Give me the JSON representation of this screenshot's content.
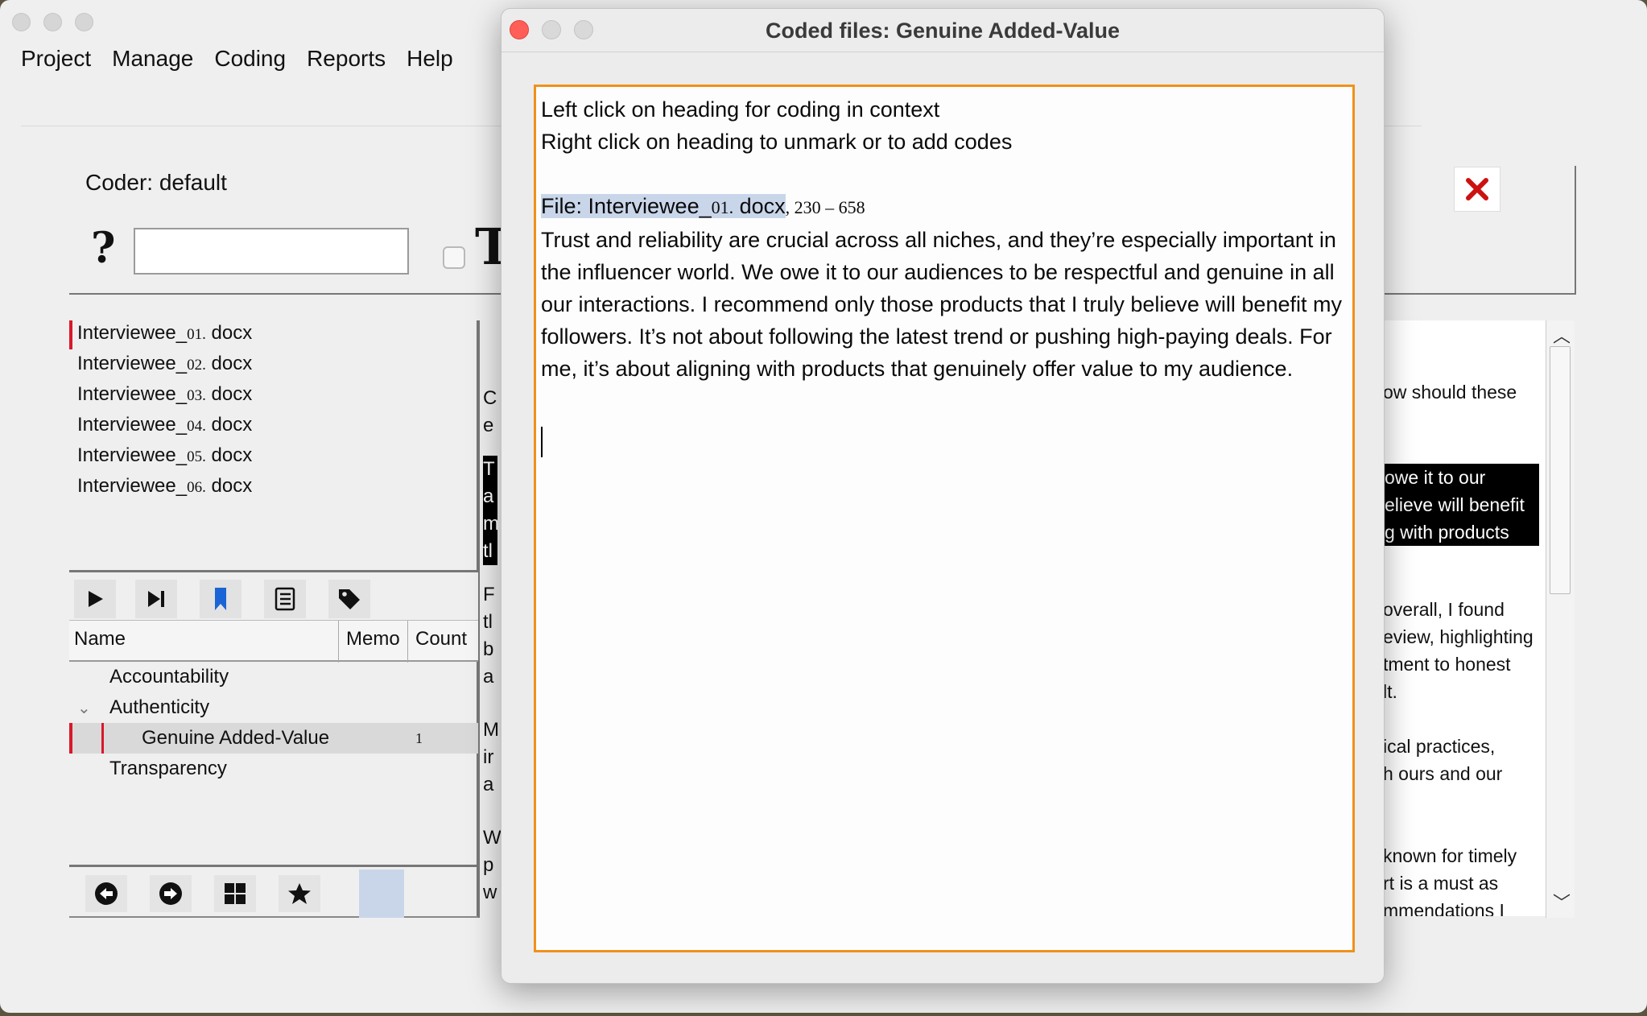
{
  "main_window": {
    "menu": [
      "Project",
      "Manage",
      "Coding",
      "Reports",
      "Help"
    ],
    "coder_label": "Coder: default",
    "help_symbol": "?",
    "search_value": "",
    "big_letter": "T",
    "files": [
      {
        "prefix": "Interviewee_",
        "num": "01.",
        "ext": " docx",
        "active": true
      },
      {
        "prefix": "Interviewee_",
        "num": "02.",
        "ext": " docx"
      },
      {
        "prefix": "Interviewee_",
        "num": "03.",
        "ext": " docx"
      },
      {
        "prefix": "Interviewee_",
        "num": "04.",
        "ext": " docx"
      },
      {
        "prefix": "Interviewee_",
        "num": "05.",
        "ext": " docx"
      },
      {
        "prefix": "Interviewee_",
        "num": "06.",
        "ext": " docx"
      }
    ],
    "code_table": {
      "headers": {
        "name": "Name",
        "memo": "Memo",
        "count": "Count"
      },
      "rows": [
        {
          "name": "Accountability",
          "count": ""
        },
        {
          "name": "Authenticity",
          "count": "",
          "expanded": true
        },
        {
          "name": "Genuine Added-Value",
          "count": "1",
          "selected": true
        },
        {
          "name": "Transparency",
          "count": ""
        }
      ]
    },
    "toolbar_icons": [
      "play-icon",
      "skip-next-icon",
      "bookmark-icon",
      "memo-list-icon",
      "tag-icon"
    ],
    "bottom_icons": [
      "back-arrow-icon",
      "forward-arrow-icon",
      "grid-icon",
      "star-icon"
    ],
    "mid_strip_letters": [
      "C",
      "e",
      "",
      "T",
      "a",
      "m",
      "tl",
      "",
      "F",
      "tl",
      "b",
      "a",
      "",
      "M",
      "ir",
      "a",
      "",
      "W",
      "p",
      "w"
    ],
    "right_text_lines": [
      "ow should these",
      "owe it to our",
      "elieve will benefit",
      "g with products",
      "overall, I found",
      "eview, highlighting",
      "tment to honest",
      "lt.",
      "ical practices,",
      "h ours and our",
      "known for timely",
      "rt is a must as",
      "mmendations I"
    ]
  },
  "dialog": {
    "title": "Coded files: Genuine Added-Value",
    "instruction_1": "Left click on heading for coding in context",
    "instruction_2": "Right click on heading to unmark or to add codes",
    "file_heading_label": "File:  Interviewee_",
    "file_heading_num": "01.",
    "file_heading_ext": " docx",
    "file_range": ", 230 – 658",
    "coded_text": "Trust and reliability are crucial across all niches, and they’re especially important in the influencer world.  We owe it to our audiences to be respectful and genuine in all our interactions.  I recommend only those products that I truly believe will benefit my followers.  It’s not about following the latest trend or pushing high-paying deals.  For me, it’s about aligning with products that genuinely offer value to my audience."
  },
  "colors": {
    "dialog_border": "#f0911a",
    "active_marker": "#d8192a",
    "close_button": "#ff5f57",
    "heading_highlight": "#c9d6ea"
  }
}
